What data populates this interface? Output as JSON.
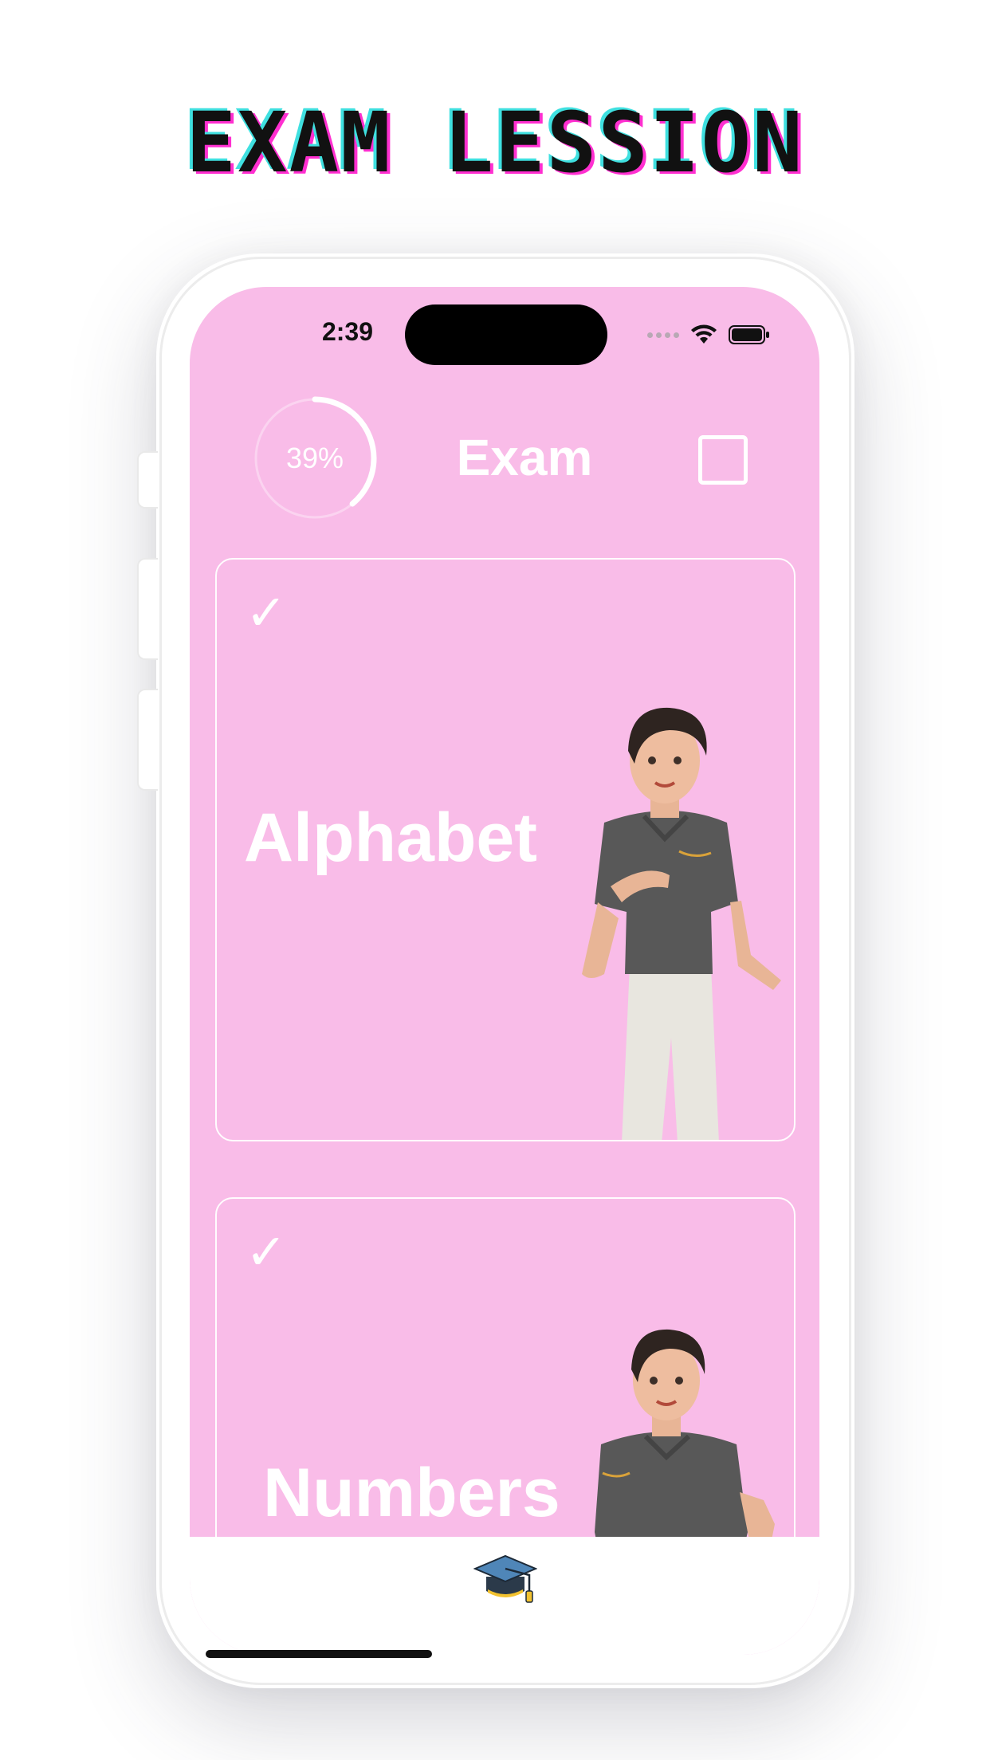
{
  "promo": {
    "headline": "EXAM LESSION"
  },
  "status_bar": {
    "time": "2:39"
  },
  "header": {
    "progress_label": "39%",
    "progress_fraction": 0.39,
    "title": "Exam"
  },
  "cards": [
    {
      "title": "Alphabet",
      "completed": true
    },
    {
      "title": "Numbers",
      "completed": true
    }
  ],
  "tab_bar": {
    "icon": "graduation-cap-icon"
  },
  "colors": {
    "screen_background": "#f9bce8",
    "text_on_screen": "#ffffff",
    "headline_cyan": "#3fe0e0",
    "headline_magenta": "#ff2fd0"
  }
}
